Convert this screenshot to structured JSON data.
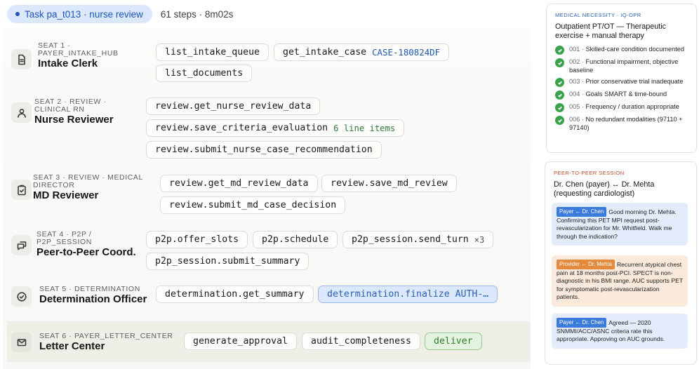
{
  "header": {
    "task_label": "Task pa_t013 · nurse review",
    "steps_label": "61 steps · 8m02s"
  },
  "seats": [
    {
      "tag_line1": "SEAT 1 ·",
      "tag_line2": "PAYER_INTAKE_HUB",
      "name": "Intake Clerk",
      "icon": "document-icon",
      "tools": [
        {
          "label": "list_intake_queue"
        },
        {
          "label": "get_intake_case",
          "arg": "CASE-180824DF"
        },
        {
          "label": "list_documents"
        }
      ]
    },
    {
      "tag_line1": "SEAT 2 · REVIEW ·",
      "tag_line2": "CLINICAL RN",
      "name": "Nurse Reviewer",
      "icon": "user-icon",
      "tools": [
        {
          "label": "review.get_nurse_review_data"
        },
        {
          "label": "review.save_criteria_evaluation",
          "note": "6 line items"
        },
        {
          "label": "review.submit_nurse_case_recommendation"
        }
      ]
    },
    {
      "tag_line1": "SEAT 3 · REVIEW · MEDICAL",
      "tag_line2": "DIRECTOR",
      "name": "MD Reviewer",
      "icon": "clipboard-check-icon",
      "tools": [
        {
          "label": "review.get_md_review_data"
        },
        {
          "label": "review.save_md_review"
        },
        {
          "label": "review.submit_md_case_decision"
        }
      ]
    },
    {
      "tag_line1": "SEAT 4 · P2P /",
      "tag_line2": "P2P_SESSION",
      "name": "Peer-to-Peer Coord.",
      "icon": "chat-icon",
      "tools": [
        {
          "label": "p2p.offer_slots"
        },
        {
          "label": "p2p.schedule"
        },
        {
          "label": "p2p_session.send_turn",
          "mult": "×3"
        },
        {
          "label": "p2p_session.submit_summary"
        }
      ]
    },
    {
      "tag_line1": "SEAT 5 · DETERMINATION",
      "tag_line2": "",
      "name": "Determination Officer",
      "icon": "check-circle-icon",
      "tools": [
        {
          "label": "determination.get_summary"
        },
        {
          "label": "determination.finalize AUTH-…",
          "style": "blue"
        }
      ]
    },
    {
      "tag_line1": "SEAT 6 · PAYER_LETTER_CENTER",
      "tag_line2": "",
      "name": "Letter Center",
      "icon": "mail-icon",
      "tools": [
        {
          "label": "generate_approval"
        },
        {
          "label": "audit_completeness"
        },
        {
          "label": "deliver",
          "style": "green"
        }
      ]
    }
  ],
  "necessity": {
    "tag": "MEDICAL NECESSITY · IQ-OPR",
    "tag_color": "#2b5fb3",
    "title": "Outpatient PT/OT — Therapeutic exercise + manual therapy",
    "criteria": [
      {
        "num": "001 ·",
        "text": "Skilled-care condition documented"
      },
      {
        "num": "002 ·",
        "text": "Functional impairment, objective baseline"
      },
      {
        "num": "003 ·",
        "text": "Prior conservative trial inadequate"
      },
      {
        "num": "004 ·",
        "text": "Goals SMART & time-bound"
      },
      {
        "num": "005 ·",
        "text": "Frequency / duration appropriate"
      },
      {
        "num": "006 ·",
        "text": "No redundant modalities (97110 + 97140)"
      }
    ]
  },
  "p2p": {
    "tag": "PEER-TO-PEER SESSION",
    "tag_color": "#c24a2b",
    "title": "Dr. Chen (payer) ↔ Dr. Mehta (requesting cardiologist)",
    "messages": [
      {
        "role": "payer",
        "who": "Payer ← Dr. Chen",
        "text": "Good morning Dr. Mehta. Confirming this PET MPI request post-revascularization for Mr. Whitfield. Walk me through the indication?"
      },
      {
        "role": "prov",
        "who": "Provider ← Dr. Mehta",
        "text": "Recurrent atypical chest pain at 18 months post-PCI. SPECT is non-diagnostic in his BMI range. AUC supports PET for symptomatic post-revascularization patients."
      },
      {
        "role": "payer",
        "who": "Payer ← Dr. Chen",
        "text": "Agreed — 2020 SNMMI/ACC/ASNC criteria rate this appropriate. Approving on AUC grounds."
      }
    ]
  }
}
